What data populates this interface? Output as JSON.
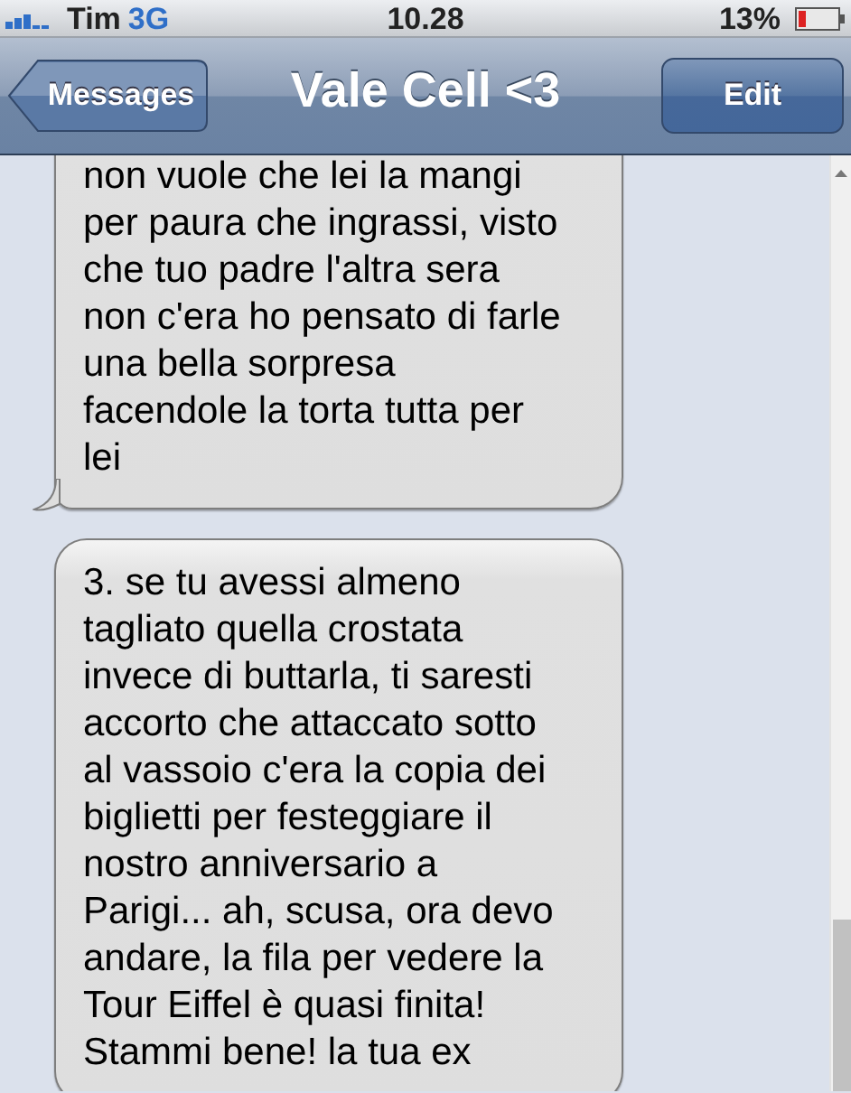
{
  "status_bar": {
    "carrier": "Tim",
    "network": "3G",
    "time": "10.28",
    "battery": "13%"
  },
  "nav": {
    "back": "Messages",
    "title": "Vale Cell <3",
    "action": "Edit"
  },
  "messages": [
    {
      "kind": "received",
      "tail": true,
      "text": "non vuole che lei la mangi\nper paura che ingrassi, visto\nche tuo padre l'altra sera\nnon c'era ho pensato di farle\nuna bella sorpresa\nfacendole la torta tutta per\nlei"
    },
    {
      "kind": "received",
      "tail": false,
      "text": "3. se tu avessi almeno\ntagliato quella crostata\ninvece di buttarla, ti saresti\naccorto che attaccato sotto\nal vassoio c'era la copia dei\nbiglietti per festeggiare il\nnostro anniversario a\nParigi... ah, scusa, ora devo\nandare, la fila per vedere la\nTour Eiffel è quasi finita!\nStammi bene! la tua ex"
    }
  ]
}
